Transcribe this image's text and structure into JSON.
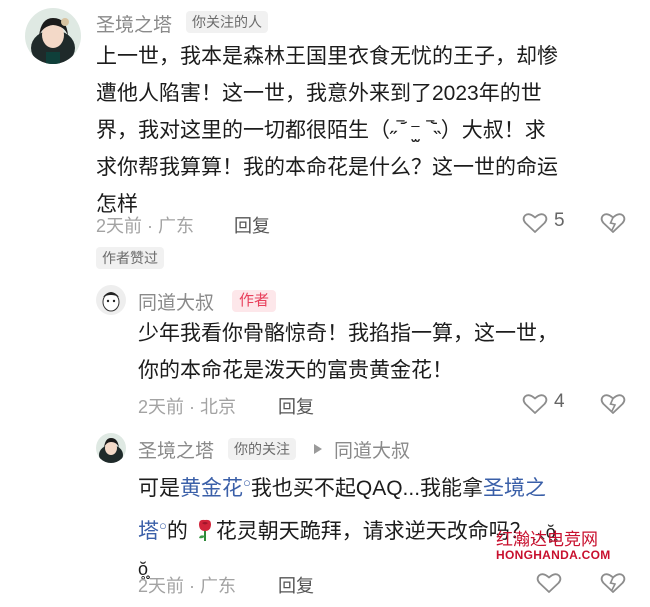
{
  "comment1": {
    "username": "圣境之塔",
    "relation_tag": "你关注的人",
    "lines": [
      "上一世，我本是森林王国里衣食无忧的王子，却惨",
      "遭他人陷害！这一世，我意外来到了2023年的世",
      "界，我对这里的一切都很陌生（˶‾᷄ ⁻̫ ‾᷅˵）大叔！求",
      "求你帮我算算！我的本命花是什么？这一世的命运",
      "怎样"
    ],
    "time_location": "2天前 · 广东",
    "reply_label": "回复",
    "like_count": "5",
    "author_liked_badge": "作者赞过"
  },
  "comment2": {
    "username": "同道大叔",
    "author_tag": "作者",
    "lines": [
      "少年我看你骨骼惊奇！我掐指一算，这一世，",
      "你的本命花是泼天的富贵黄金花！"
    ],
    "time_location": "2天前 · 北京",
    "reply_label": "回复",
    "like_count": "4"
  },
  "comment3": {
    "username": "圣境之塔",
    "relation_tag": "你的关注",
    "reply_to": "同道大叔",
    "line1_pre": "可是",
    "line1_link": "黄金花",
    "line1_post": "我也买不起QAQ...我能拿",
    "line1_link2": "圣境之",
    "line2_link": "塔",
    "line2_mid": "的",
    "line2_post": "花灵朝天跪拜，请求逆天改命吗？",
    "emoticon": "ˏ⸜ŏ̥̥̥",
    "line3": "ŏ̥̥̥",
    "time_location": "2天前 · 广东",
    "reply_label": "回复"
  },
  "watermark": {
    "cn": "红瀚达电竞网",
    "en": "HONGHANDA.COM"
  },
  "colors": {
    "link": "#3a5fa8",
    "author_tag": "#e8405c",
    "watermark": "#c8102e"
  }
}
